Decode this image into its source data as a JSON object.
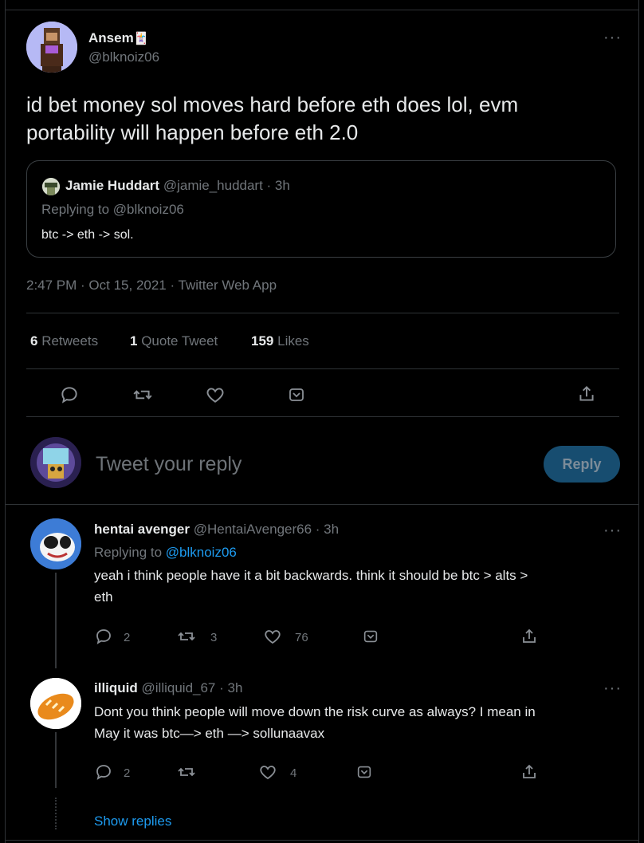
{
  "main_tweet": {
    "display_name": "Ansem",
    "name_emoji": "🃏",
    "handle": "@blknoiz06",
    "text_line1": "id bet money sol moves hard before eth does lol, evm",
    "text_line2": "portability will happen before eth 2.0",
    "meta": "2:47 PM · Oct 15, 2021 · Twitter Web App"
  },
  "quoted": {
    "display_name": "Jamie Huddart",
    "handle_time": "@jamie_huddart · 3h",
    "replying_to": "Replying to @blknoiz06",
    "text": "btc -> eth -> sol."
  },
  "stats": {
    "retweets_count": "6",
    "retweets_label": "Retweets",
    "quotes_count": "1",
    "quotes_label": "Quote Tweet",
    "likes_count": "159",
    "likes_label": "Likes"
  },
  "composer": {
    "placeholder": "Tweet your reply",
    "reply_button": "Reply"
  },
  "replies": [
    {
      "display_name": "hentai avenger",
      "handle_time": "@HentaiAvenger66 · 3h",
      "replying_prefix": "Replying to ",
      "replying_handle": "@blknoiz06",
      "text_line1": "yeah i think people have it a bit backwards. think it should be btc > alts >",
      "text_line2": "eth",
      "reply_count": "2",
      "retweet_count": "3",
      "like_count": "76"
    },
    {
      "display_name": "illiquid",
      "handle_time": "@illiquid_67 · 3h",
      "text_line1": "Dont you think people will move down the risk curve as always? I mean in",
      "text_line2": "May it was btc—> eth —> sollunaavax",
      "reply_count": "2",
      "like_count": "4"
    }
  ],
  "show_replies": "Show replies",
  "more_glyph": "···"
}
